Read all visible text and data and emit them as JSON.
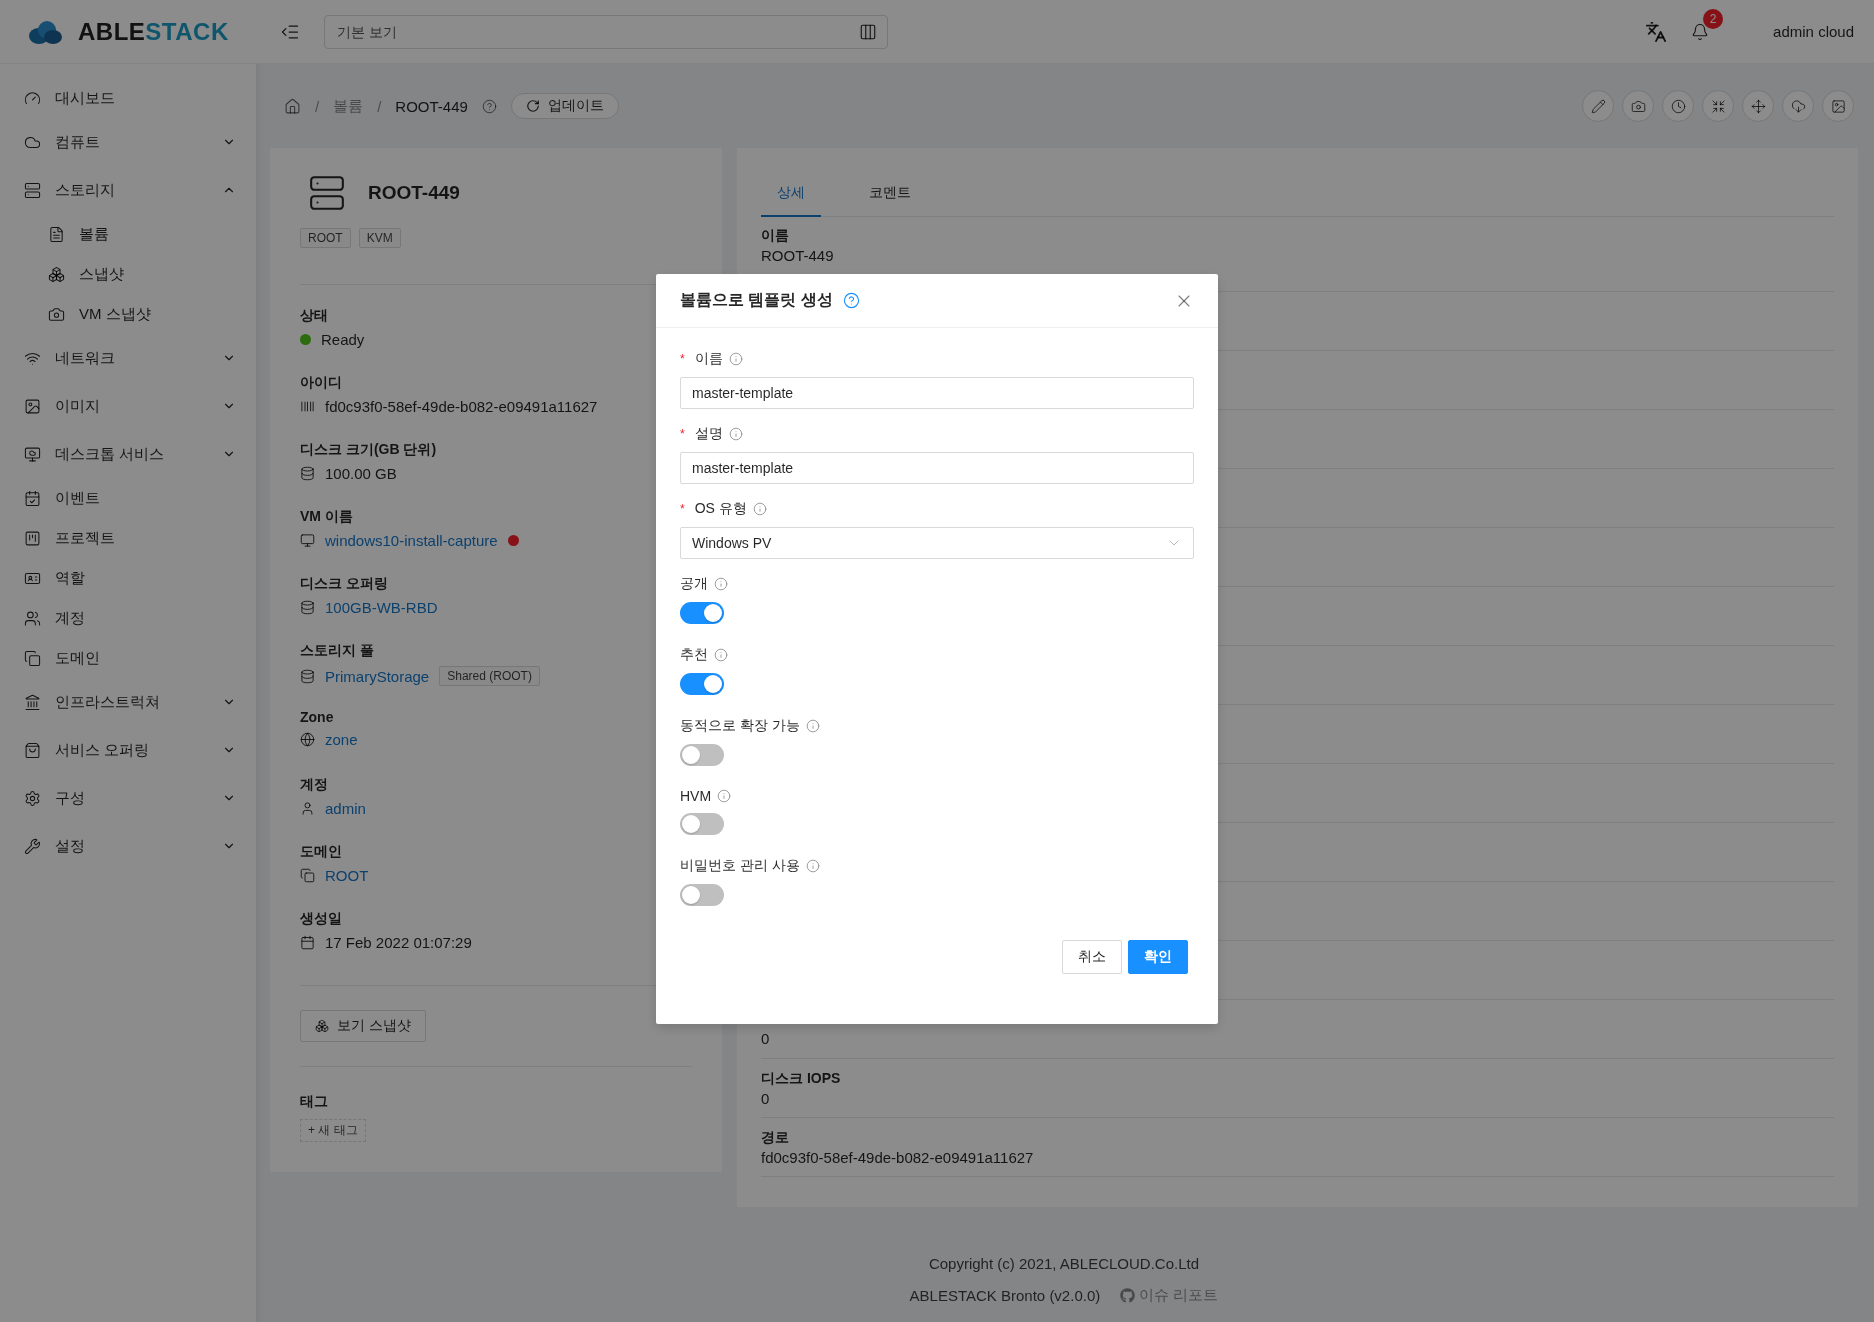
{
  "header": {
    "logo_parts": [
      "ABLE",
      "STACK"
    ],
    "view_field": {
      "placeholder": "기본 보기"
    },
    "notification_count": "2",
    "user": "admin cloud"
  },
  "sidebar": {
    "items": [
      {
        "label": "대시보드",
        "has_children": false
      },
      {
        "label": "컴퓨트",
        "has_children": true,
        "expanded": false
      },
      {
        "label": "스토리지",
        "has_children": true,
        "expanded": true,
        "children": [
          {
            "label": "볼륨"
          },
          {
            "label": "스냅샷"
          },
          {
            "label": "VM 스냅샷"
          }
        ]
      },
      {
        "label": "네트워크",
        "has_children": true,
        "expanded": false
      },
      {
        "label": "이미지",
        "has_children": true,
        "expanded": false
      },
      {
        "label": "데스크톱 서비스",
        "has_children": true,
        "expanded": false
      },
      {
        "label": "이벤트",
        "has_children": false
      },
      {
        "label": "프로젝트",
        "has_children": false
      },
      {
        "label": "역할",
        "has_children": false
      },
      {
        "label": "계정",
        "has_children": false
      },
      {
        "label": "도메인",
        "has_children": false
      },
      {
        "label": "인프라스트럭쳐",
        "has_children": true,
        "expanded": false
      },
      {
        "label": "서비스 오퍼링",
        "has_children": true,
        "expanded": false
      },
      {
        "label": "구성",
        "has_children": true,
        "expanded": false
      },
      {
        "label": "설정",
        "has_children": true,
        "expanded": false
      }
    ]
  },
  "breadcrumb": {
    "items": [
      "/",
      "볼륨",
      "/",
      "ROOT-449"
    ],
    "refresh_button": "업데이트"
  },
  "resource_card": {
    "title": "ROOT-449",
    "tags": [
      "ROOT",
      "KVM"
    ],
    "fields": [
      {
        "label": "상태",
        "kind": "status",
        "value": "Ready",
        "color": "#2d6c0e"
      },
      {
        "label": "아이디",
        "kind": "text",
        "value": "fd0c93f0-58ef-49de-b082-e09491a11627"
      },
      {
        "label": "디스크 크기(GB 단위)",
        "kind": "text",
        "value": "100.00 GB"
      },
      {
        "label": "VM 이름",
        "kind": "link",
        "value": "windows10-install-capture",
        "color": "#871319"
      },
      {
        "label": "디스크 오퍼링",
        "kind": "link",
        "value": "100GB-WB-RBD"
      },
      {
        "label": "스토리지 풀",
        "kind": "link",
        "value": "PrimaryStorage",
        "tag": "Shared (ROOT)"
      },
      {
        "label": "Zone",
        "kind": "link",
        "value": "zone"
      },
      {
        "label": "계정",
        "kind": "link",
        "value": "admin"
      },
      {
        "label": "도메인",
        "kind": "link",
        "value": "ROOT"
      },
      {
        "label": "생성일",
        "kind": "text",
        "value": "17 Feb 2022 01:07:29"
      }
    ],
    "snapshot_button": "보기 스냅샷",
    "tags_label": "태그",
    "new_tag_button": "+ 새 태그"
  },
  "detail_panel": {
    "tabs": [
      {
        "label": "상세",
        "selected": true
      },
      {
        "label": "코멘트",
        "selected": false
      }
    ],
    "top_rows": [
      {
        "label": "이름",
        "value": "ROOT-449"
      }
    ],
    "bottom_rows": [
      {
        "value": "0"
      },
      {
        "label": "디스크 IOPS",
        "value": "0"
      },
      {
        "label": "경로",
        "value": "fd0c93f0-58ef-49de-b082-e09491a11627"
      }
    ]
  },
  "footer": {
    "copyright": "Copyright (c) 2021, ABLECLOUD.Co.Ltd",
    "version": "ABLESTACK Bronto (v2.0.0)",
    "issue_link": "이슈 리포트"
  },
  "dialog": {
    "title": "볼륨으로 템플릿 생성",
    "required_mark": "*",
    "fields": [
      {
        "kind": "input",
        "label": "이름",
        "required": true,
        "value": "master-template"
      },
      {
        "kind": "input",
        "label": "설명",
        "required": true,
        "value": "master-template"
      },
      {
        "kind": "select",
        "label": "OS 유형",
        "required": true,
        "value": "Windows PV"
      },
      {
        "kind": "switch",
        "label": "공개",
        "required": false,
        "on": true
      },
      {
        "kind": "switch",
        "label": "추천",
        "required": false,
        "on": true
      },
      {
        "kind": "switch",
        "label": "동적으로 확장 가능",
        "required": false,
        "on": false
      },
      {
        "kind": "switch",
        "label": "HVM",
        "required": false,
        "on": false
      },
      {
        "kind": "switch",
        "label": "비밀번호 관리 사용",
        "required": false,
        "on": false
      }
    ],
    "buttons": [
      {
        "label": "취소",
        "kind": "default"
      },
      {
        "label": "확인",
        "kind": "primary"
      }
    ]
  }
}
